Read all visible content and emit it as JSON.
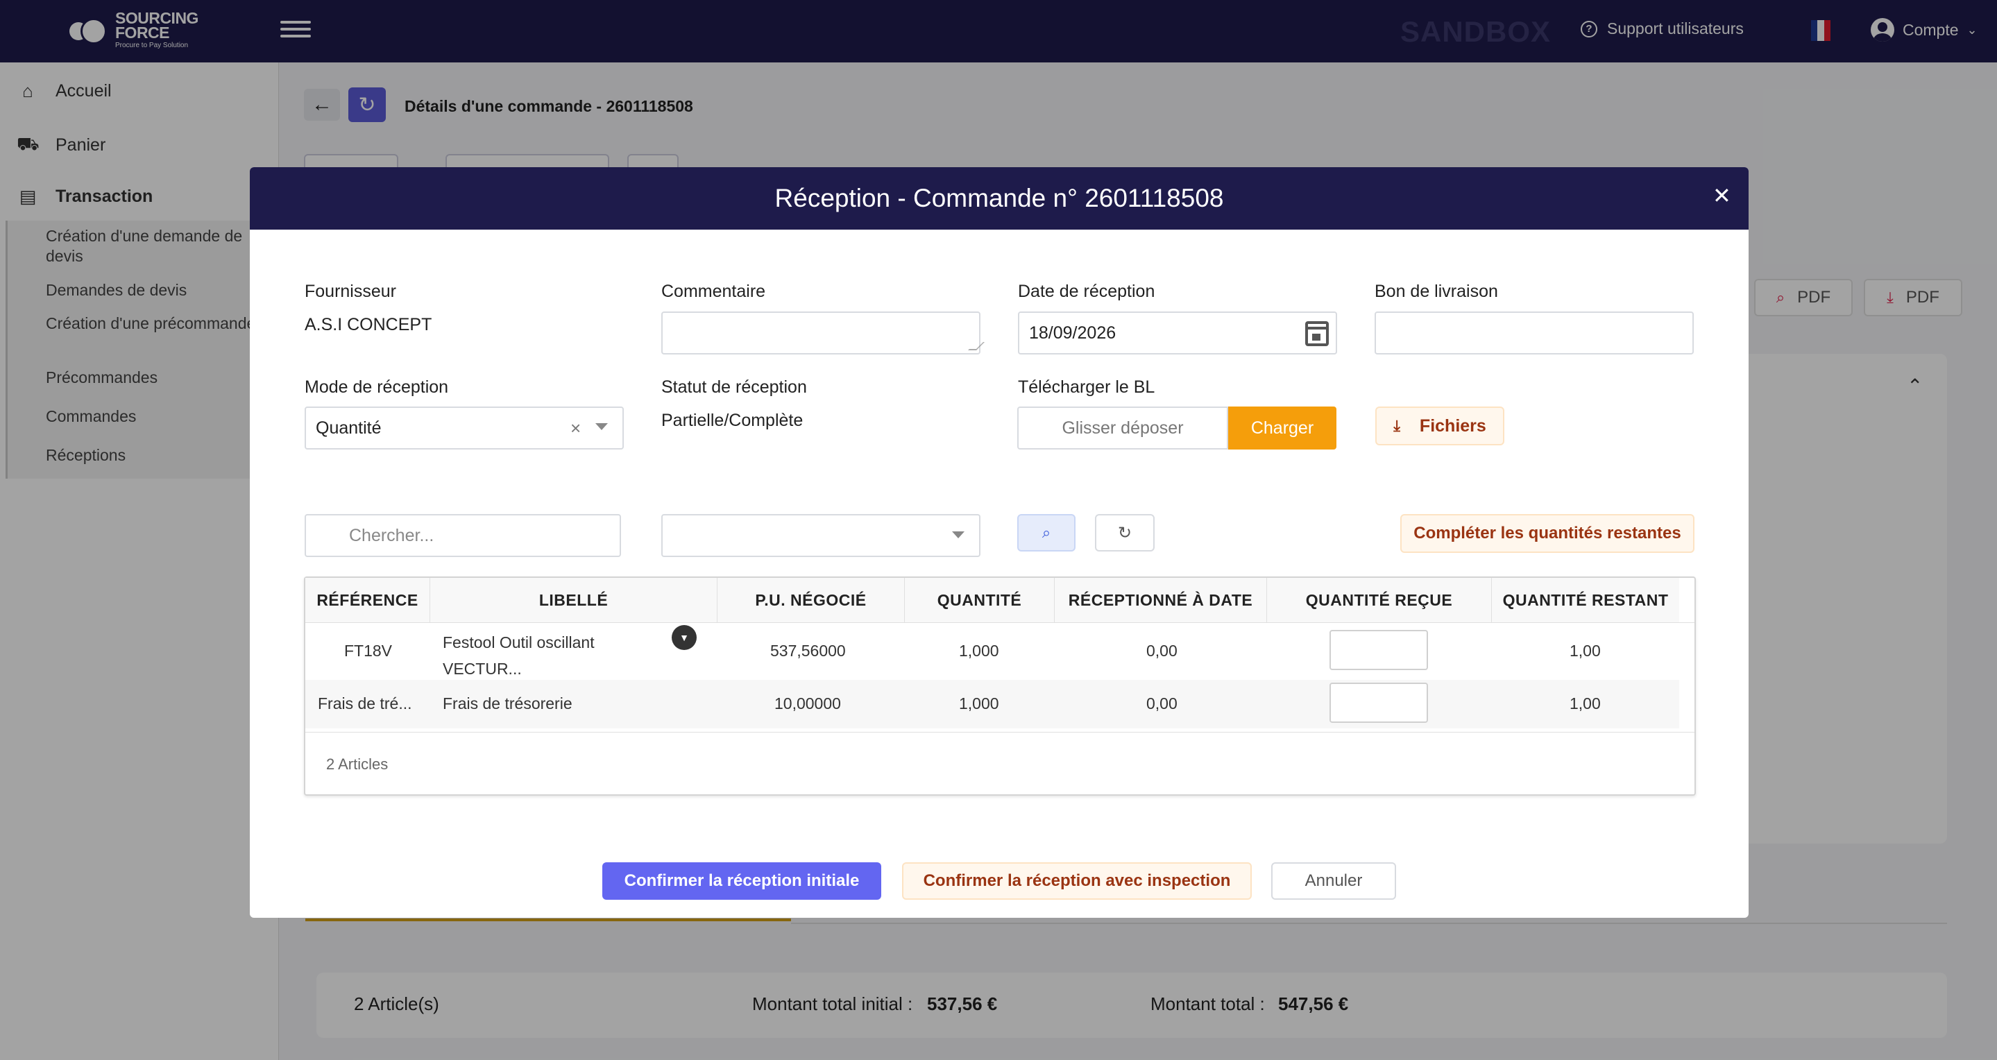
{
  "topbar": {
    "logo_line1": "SOURCING",
    "logo_line2": "FORCE",
    "logo_tagline": "Procure to Pay Solution",
    "env_label": "SANDBOX",
    "support_label": "Support utilisateurs",
    "account_label": "Compte",
    "brand_color": "#1e1b4b"
  },
  "sidebar": {
    "items": [
      {
        "label": "Accueil",
        "icon": "home-icon"
      },
      {
        "label": "Panier",
        "icon": "basket-icon"
      },
      {
        "label": "Transaction",
        "icon": "receipt-icon"
      }
    ],
    "subitems": [
      "Création d'une demande de devis",
      "Demandes de devis",
      "Création d'une précommande",
      "Précommandes",
      "Commandes",
      "Réceptions"
    ]
  },
  "page": {
    "title": "Détails d'une commande - 2601118508",
    "pdf_label_1": "PDF",
    "pdf_label_2": "PDF",
    "footer_articles": "2 Article(s)",
    "footer_initial_label": "Montant total initial :",
    "footer_initial_value": "537,56 €",
    "footer_total_label": "Montant total :",
    "footer_total_value": "547,56 €"
  },
  "modal": {
    "title": "Réception - Commande n° 2601118508",
    "fournisseur_label": "Fournisseur",
    "fournisseur_value": "A.S.I CONCEPT",
    "commentaire_label": "Commentaire",
    "date_label": "Date de réception",
    "date_value": "18/09/2026",
    "bon_label": "Bon de livraison",
    "mode_label": "Mode de réception",
    "mode_value": "Quantité",
    "statut_label": "Statut de réception",
    "statut_value": "Partielle/Complète",
    "upload_label": "Télécharger le BL",
    "drop_label": "Glisser déposer",
    "charger_label": "Charger",
    "fichiers_label": "Fichiers",
    "search_placeholder": "Chercher...",
    "complete_label": "Compléter les quantités restantes",
    "table": {
      "headers": [
        "RÉFÉRENCE",
        "LIBELLÉ",
        "P.U. NÉGOCIÉ",
        "QUANTITÉ",
        "RÉCEPTIONNÉ À DATE",
        "QUANTITÉ REÇUE",
        "QUANTITÉ RESTANT"
      ],
      "rows": [
        {
          "ref": "FT18V",
          "libelle_1": "Festool Outil oscillant",
          "libelle_2": "VECTUR...",
          "pu": "537,56000",
          "qte": "1,000",
          "recu_date": "0,00",
          "restant": "1,00"
        },
        {
          "ref": "Frais de tré...",
          "libelle_1": "Frais de trésorerie",
          "libelle_2": "",
          "pu": "10,00000",
          "qte": "1,000",
          "recu_date": "0,00",
          "restant": "1,00"
        }
      ],
      "count": "2 Articles"
    },
    "confirm_initial": "Confirmer la réception initiale",
    "confirm_inspect": "Confirmer la réception avec inspection",
    "cancel": "Annuler",
    "accent_color": "#6366f1",
    "orange_color": "#f59e0b"
  }
}
